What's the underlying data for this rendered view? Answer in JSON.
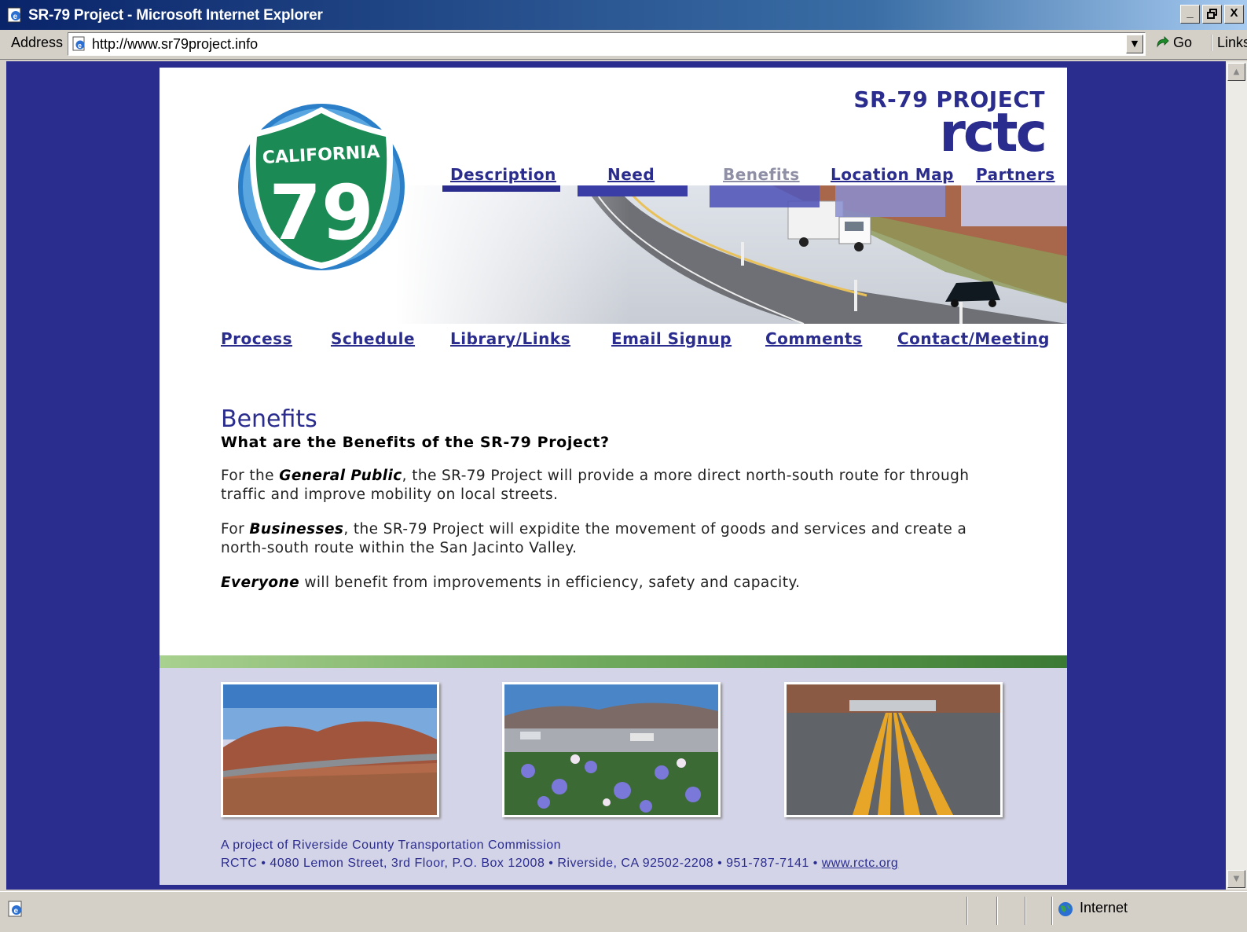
{
  "window": {
    "title": "SR-79 Project - Microsoft Internet Explorer",
    "minimize_label": "_",
    "maximize_label": "🗗",
    "close_label": "X"
  },
  "address_bar": {
    "label": "Address",
    "url": "http://www.sr79project.info",
    "go_label": "Go",
    "links_label": "Links"
  },
  "site": {
    "brand_title": "SR-79 PROJECT",
    "brand_logo": "rctc",
    "shield": {
      "top": "CALIFORNIA",
      "number": "79"
    },
    "top_nav": [
      "Description",
      "Need",
      "Benefits",
      "Location Map",
      "Partners"
    ],
    "current_top_nav": "Benefits",
    "sub_nav": [
      "Process",
      "Schedule",
      "Library/Links",
      "Email Signup",
      "Comments",
      "Contact/Meeting"
    ]
  },
  "content": {
    "heading": "Benefits",
    "subheading": "What are the Benefits of the SR-79 Project?",
    "p1_prefix": "For the ",
    "p1_bold": "General Public",
    "p1_rest": ", the SR-79 Project will provide a more direct north-south route for through traffic and improve mobility on local streets.",
    "p2_prefix": "For ",
    "p2_bold": "Businesses",
    "p2_rest": ", the SR-79 Project will expidite the movement of goods and services and create a north-south route within the San Jacinto Valley.",
    "p3_bold": "Everyone",
    "p3_rest": " will benefit from improvements in efficiency, safety and capacity."
  },
  "footer": {
    "line1": "A project of Riverside County Transportation Commission",
    "line2": "RCTC • 4080 Lemon Street, 3rd Floor, P.O. Box 12008 • Riverside, CA 92502-2208 • 951-787-7141 • ",
    "link": "www.rctc.org"
  },
  "status_bar": {
    "zone": "Internet"
  },
  "colors": {
    "navy": "#2b2d8e",
    "page_bg": "#ffffff",
    "footer_bg": "#d4d4e8",
    "shield_green": "#1b8a55",
    "shield_ring": "#2a7fc8"
  },
  "icons": {
    "window": "ie-page-icon",
    "go": "go-arrow-icon",
    "status": "page-done-icon",
    "zone": "globe-icon"
  }
}
